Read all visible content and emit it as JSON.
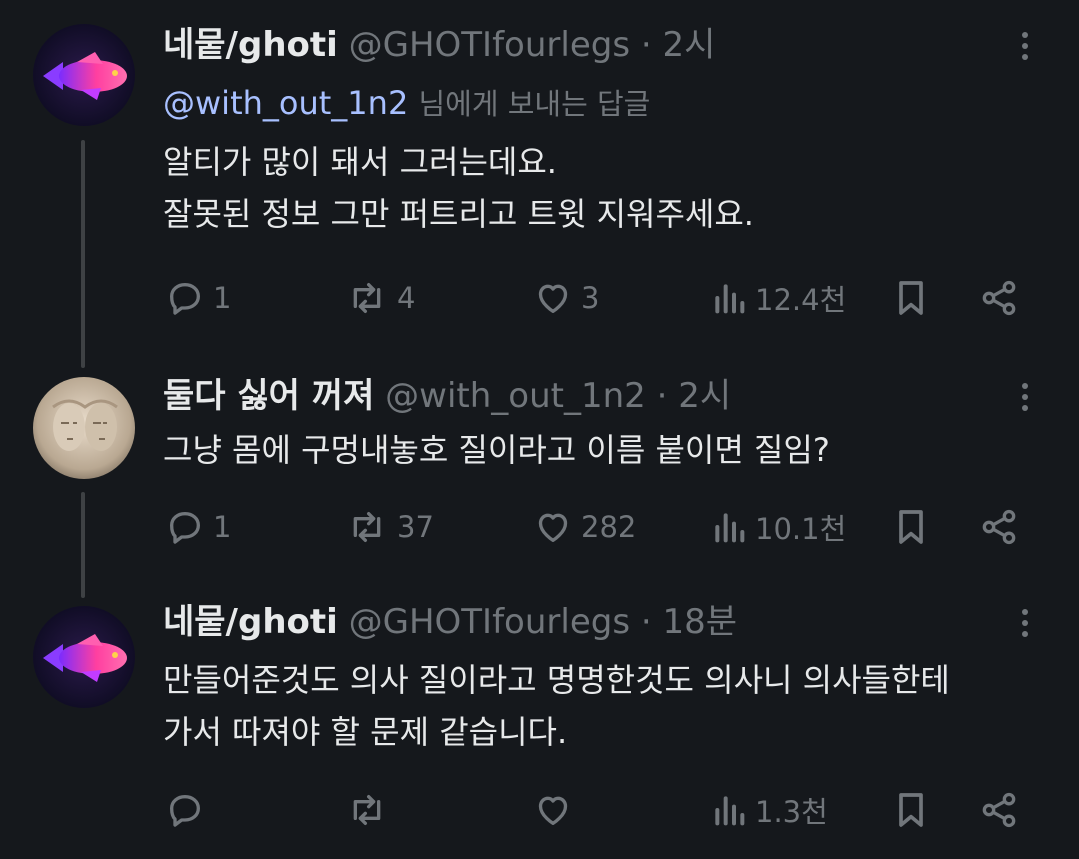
{
  "tweets": [
    {
      "name": "네뭍/ghoti",
      "handle": "@GHOTIfourlegs",
      "sep": "·",
      "time": "2시",
      "reply_to": {
        "handle": "@with_out_1n2",
        "suffix": "님에게 보내는 답글"
      },
      "lines": [
        "알티가 많이 돼서 그러는데요.",
        "잘못된 정보 그만 퍼트리고 트윗 지워주세요."
      ],
      "replies": "1",
      "retweets": "4",
      "likes": "3",
      "views": "12.4천"
    },
    {
      "name": "둘다 싫어 꺼져",
      "handle": "@with_out_1n2",
      "sep": "·",
      "time": "2시",
      "lines": [
        "그냥 몸에 구멍내놓호 질이라고 이름 붙이면 질임?"
      ],
      "replies": "1",
      "retweets": "37",
      "likes": "282",
      "views": "10.1천"
    },
    {
      "name": "네뭍/ghoti",
      "handle": "@GHOTIfourlegs",
      "sep": "·",
      "time": "18분",
      "lines": [
        "만들어준것도 의사 질이라고 명명한것도 의사니 의사들한테",
        "가서 따져야 할 문제 같습니다."
      ],
      "replies": "",
      "retweets": "",
      "likes": "",
      "views": "1.3천"
    }
  ],
  "colors": {
    "background": "#15181c",
    "text": "#e7e9ea",
    "muted": "#71767b",
    "mention": "#a8c0ff",
    "thread_line": "#3e4144"
  }
}
